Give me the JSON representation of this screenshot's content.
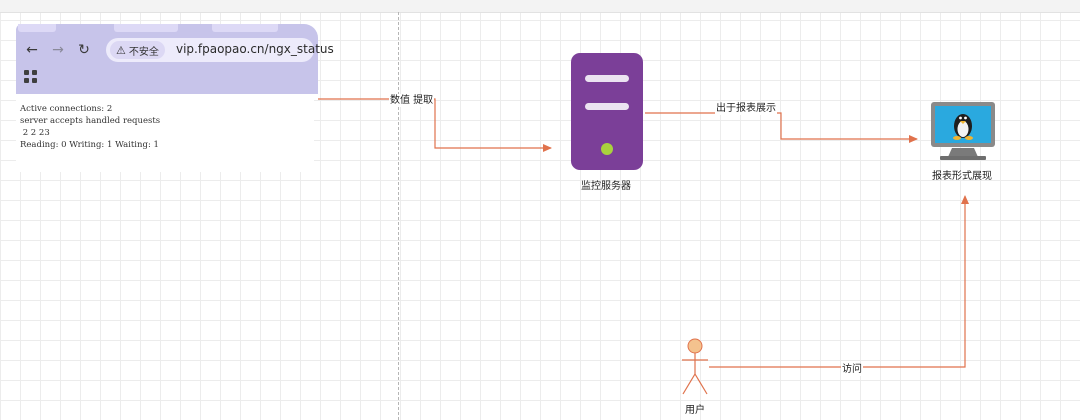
{
  "browser": {
    "url": "vip.fpaopao.cn/ngx_status",
    "security_label": "不安全",
    "status_lines": [
      "Active connections: 2",
      "server accepts handled requests",
      " 2 2 23",
      "Reading: 0 Writing: 1 Waiting: 1"
    ]
  },
  "nodes": {
    "server": {
      "label": "监控服务器",
      "color": "#7b3f98",
      "led_color": "#a9d23d"
    },
    "display": {
      "label": "报表形式展现"
    },
    "user": {
      "label": "用户",
      "color": "#f4c28e"
    }
  },
  "edges": {
    "extract": "数值 提取",
    "report": "出于报表展示",
    "visit": "访问"
  },
  "colors": {
    "connector": "#e0724c",
    "grid": "#ececec"
  }
}
